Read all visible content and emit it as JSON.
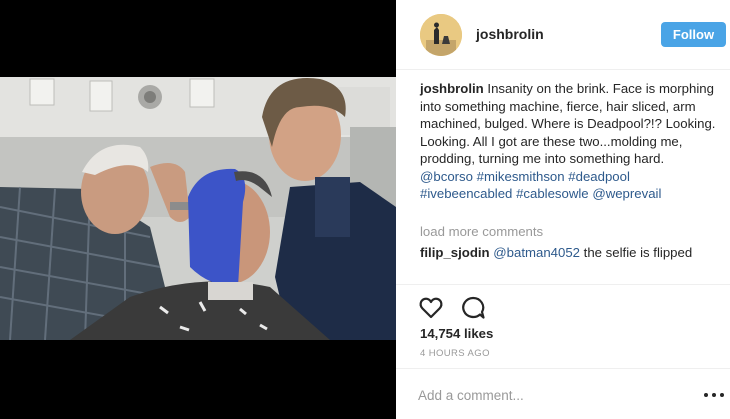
{
  "post": {
    "image_alt": "Selfie of Josh Brolin in the makeup chair with blue mold on his face, two artists behind him",
    "header": {
      "username": "joshbrolin",
      "avatar_icon": "profile-avatar-icon",
      "follow_label": "Follow"
    },
    "caption": {
      "username": "joshbrolin",
      "text": "Insanity on the brink. Face is morphing into something machine, fierce, hair sliced, arm machined, bulged. Where is Deadpool?!? Looking. Looking. All I got are these two...molding me, prodding, turning me into something hard.",
      "tags": [
        "@bcorso",
        "#mikesmithson",
        "#deadpool",
        "#ivebeencabled",
        "#cablesowle",
        "@weprevail"
      ]
    },
    "load_more_label": "load more comments",
    "comments": [
      {
        "username": "filip_sjodin",
        "mention": "@batman4052",
        "text": "the selfie is flipped"
      }
    ],
    "actions": {
      "like_icon": "heart-icon",
      "comment_icon": "comment-bubble-icon"
    },
    "likes": "14,754 likes",
    "timestamp": "4 HOURS AGO",
    "add_comment_placeholder": "Add a comment...",
    "more_icon": "more-options-icon"
  },
  "colors": {
    "follow_button": "#4aa4e6",
    "tag_link": "#2e5a8c",
    "muted_text": "#999999",
    "media_background": "#000000"
  }
}
